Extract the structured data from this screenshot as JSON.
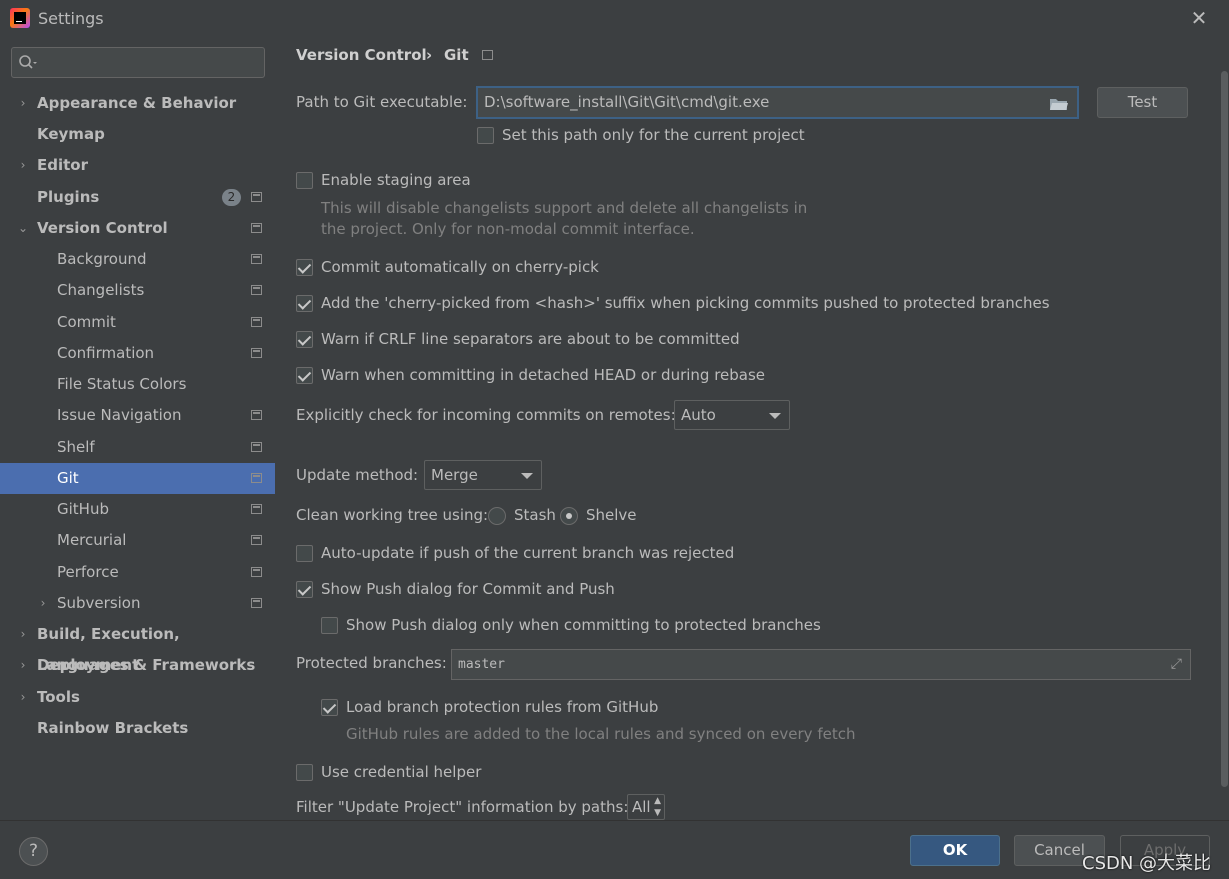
{
  "window": {
    "title": "Settings"
  },
  "sidebar": {
    "search_placeholder": "",
    "items": [
      {
        "label": "Appearance & Behavior"
      },
      {
        "label": "Keymap"
      },
      {
        "label": "Editor"
      },
      {
        "label": "Plugins",
        "badge": "2"
      },
      {
        "label": "Version Control"
      },
      {
        "label": "Background"
      },
      {
        "label": "Changelists"
      },
      {
        "label": "Commit"
      },
      {
        "label": "Confirmation"
      },
      {
        "label": "File Status Colors"
      },
      {
        "label": "Issue Navigation"
      },
      {
        "label": "Shelf"
      },
      {
        "label": "Git"
      },
      {
        "label": "GitHub"
      },
      {
        "label": "Mercurial"
      },
      {
        "label": "Perforce"
      },
      {
        "label": "Subversion"
      },
      {
        "label": "Build, Execution, Deployment"
      },
      {
        "label": "Languages & Frameworks"
      },
      {
        "label": "Tools"
      },
      {
        "label": "Rainbow Brackets"
      }
    ]
  },
  "breadcrumb": {
    "parent": "Version Control",
    "separator": "›",
    "current": "Git"
  },
  "git": {
    "path_label": "Path to Git executable:",
    "path_value": "D:\\software_install\\Git\\Git\\cmd\\git.exe",
    "test_label": "Test",
    "path_project_only": "Set this path only for the current project",
    "staging_label": "Enable staging area",
    "staging_hint_1": "This will disable changelists support and delete all changelists in",
    "staging_hint_2": "the project. Only for non-modal commit interface.",
    "cherry_pick": "Commit automatically on cherry-pick",
    "cherry_suffix": "Add the 'cherry-picked from <hash>' suffix when picking commits pushed to protected branches",
    "crlf": "Warn if CRLF line separators are about to be committed",
    "detached": "Warn when committing in detached HEAD or during rebase",
    "incoming_label": "Explicitly check for incoming commits on remotes:",
    "incoming_value": "Auto",
    "update_label": "Update method:",
    "update_value": "Merge",
    "clean_label": "Clean working tree using:",
    "stash_label": "Stash",
    "shelve_label": "Shelve",
    "auto_update": "Auto-update if push of the current branch was rejected",
    "show_push": "Show Push dialog for Commit and Push",
    "show_push_protected": "Show Push dialog only when committing to protected branches",
    "protected_label": "Protected branches:",
    "protected_value": "master",
    "load_rules": "Load branch protection rules from GitHub",
    "load_rules_hint": "GitHub rules are added to the local rules and synced on every fetch",
    "credential": "Use credential helper",
    "filter_label": "Filter \"Update Project\" information by paths:",
    "filter_value": "All"
  },
  "footer": {
    "help": "?",
    "ok": "OK",
    "cancel": "Cancel",
    "apply": "Apply",
    "watermark": "CSDN @大菜比"
  }
}
